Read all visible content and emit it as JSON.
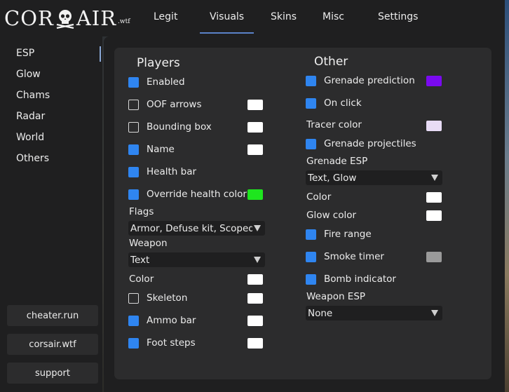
{
  "header": {
    "logo_text": "CORSAIR",
    "logo_suffix": ".wtf",
    "tabs": [
      {
        "label": "Legit"
      },
      {
        "label": "Visuals"
      },
      {
        "label": "Skins"
      },
      {
        "label": "Misc"
      },
      {
        "label": "Settings"
      }
    ],
    "active_tab": "Visuals"
  },
  "sidebar": {
    "items": [
      {
        "label": "ESP"
      },
      {
        "label": "Glow"
      },
      {
        "label": "Chams"
      },
      {
        "label": "Radar"
      },
      {
        "label": "World"
      },
      {
        "label": "Others"
      }
    ],
    "active_item": "ESP",
    "buttons": [
      {
        "label": "cheater.run"
      },
      {
        "label": "corsair.wtf"
      },
      {
        "label": "support"
      }
    ]
  },
  "players": {
    "title": "Players",
    "enabled": {
      "label": "Enabled",
      "checked": true
    },
    "oof_arrows": {
      "label": "OOF arrows",
      "checked": false,
      "color": "#ffffff"
    },
    "bounding_box": {
      "label": "Bounding box",
      "checked": false,
      "color": "#ffffff"
    },
    "name": {
      "label": "Name",
      "checked": true,
      "color": "#ffffff"
    },
    "health_bar": {
      "label": "Health bar",
      "checked": true
    },
    "override_health_color": {
      "label": "Override health color",
      "checked": true,
      "color": "#1ee61e"
    },
    "flags": {
      "label": "Flags",
      "value": "Armor, Defuse kit, Scoped,"
    },
    "weapon": {
      "label": "Weapon",
      "value": "Text"
    },
    "color": {
      "label": "Color",
      "color": "#ffffff"
    },
    "skeleton": {
      "label": "Skeleton",
      "checked": false,
      "color": "#ffffff"
    },
    "ammo_bar": {
      "label": "Ammo bar",
      "checked": true,
      "color": "#ffffff"
    },
    "foot_steps": {
      "label": "Foot steps",
      "checked": true,
      "color": "#ffffff"
    }
  },
  "other": {
    "title": "Other",
    "grenade_prediction": {
      "label": "Grenade prediction",
      "checked": true,
      "color": "#7a0af0"
    },
    "on_click": {
      "label": "On click",
      "checked": true
    },
    "tracer_color": {
      "label": "Tracer color",
      "color": "#e8dcf5"
    },
    "grenade_projectiles": {
      "label": "Grenade projectiles",
      "checked": true
    },
    "grenade_esp": {
      "label": "Grenade ESP",
      "value": "Text, Glow"
    },
    "color": {
      "label": "Color",
      "color": "#ffffff"
    },
    "glow_color": {
      "label": "Glow color",
      "color": "#ffffff"
    },
    "fire_range": {
      "label": "Fire range",
      "checked": true
    },
    "smoke_timer": {
      "label": "Smoke timer",
      "checked": true,
      "color": "#9a9a9a"
    },
    "bomb_indicator": {
      "label": "Bomb indicator",
      "checked": true
    },
    "weapon_esp": {
      "label": "Weapon ESP",
      "value": "None"
    }
  }
}
